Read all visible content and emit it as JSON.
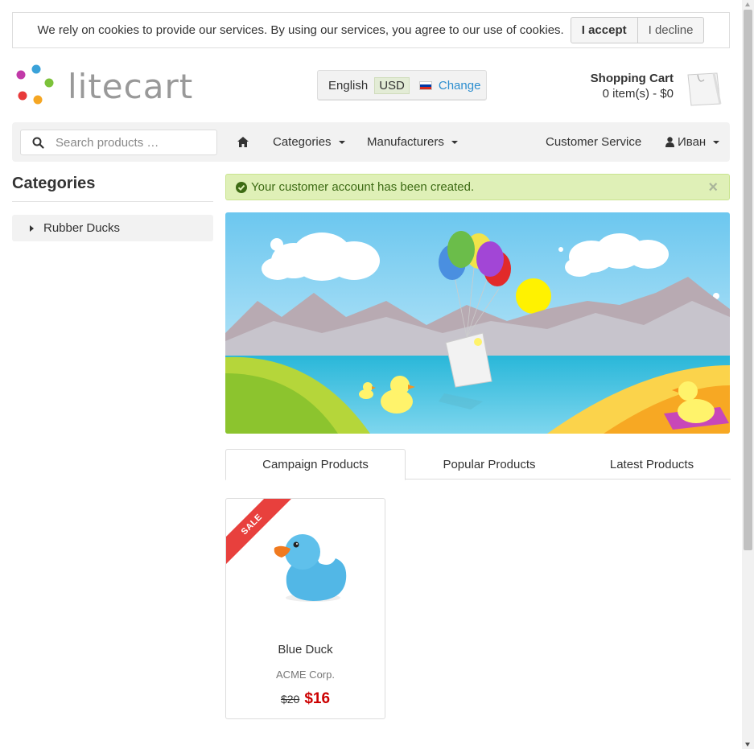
{
  "cookie_notice": {
    "text": "We rely on cookies to provide our services. By using our services, you agree to our use of cookies.",
    "accept_label": "I accept",
    "decline_label": "I decline"
  },
  "header": {
    "logo_text": "litecart",
    "region": {
      "language": "English",
      "currency": "USD",
      "flag_icon": "russia-flag-icon",
      "change_label": "Change"
    },
    "cart": {
      "title": "Shopping Cart",
      "summary": "0 item(s) - $0",
      "icon": "shopping-bag-icon"
    }
  },
  "navbar": {
    "search_placeholder": "Search products …",
    "home_icon": "home-icon",
    "categories_label": "Categories",
    "manufacturers_label": "Manufacturers",
    "customer_service_label": "Customer Service",
    "account_label": "Иван",
    "account_icon": "user-icon"
  },
  "sidebar": {
    "title": "Categories",
    "items": [
      {
        "label": "Rubber Ducks"
      }
    ]
  },
  "alert": {
    "message": "Your customer account has been created.",
    "icon": "check-circle-icon",
    "close_symbol": "×"
  },
  "tabs": [
    {
      "label": "Campaign Products",
      "active": true
    },
    {
      "label": "Popular Products",
      "active": false
    },
    {
      "label": "Latest Products",
      "active": false
    }
  ],
  "products": [
    {
      "badge": "SALE",
      "name": "Blue Duck",
      "manufacturer": "ACME Corp.",
      "old_price": "$20",
      "price": "$16"
    }
  ],
  "colors": {
    "accent_link": "#2c8ecf",
    "sale_red": "#e8403d",
    "price_red": "#cc0000",
    "alert_bg": "#dff0b7",
    "alert_text": "#3d6b14"
  }
}
